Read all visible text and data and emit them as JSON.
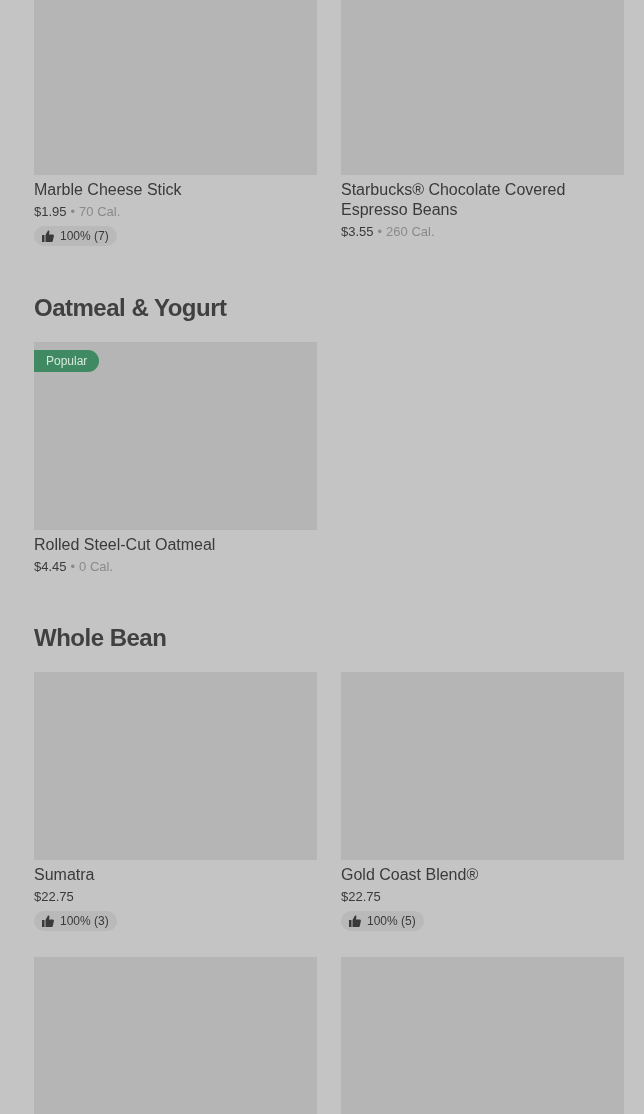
{
  "sections": [
    {
      "items": [
        {
          "kind": "product",
          "name": "Marble Cheese Stick",
          "price": "$1.95",
          "separator": "•",
          "calories": "70 Cal.",
          "rating": "100% (7)"
        },
        {
          "kind": "product",
          "name": "Starbucks® Chocolate Covered Espresso Beans",
          "price": "$3.55",
          "separator": "•",
          "calories": "260 Cal."
        }
      ]
    },
    {
      "title": "Oatmeal & Yogurt",
      "items": [
        {
          "kind": "product",
          "badge": "Popular",
          "name": "Rolled Steel-Cut Oatmeal",
          "price": "$4.45",
          "separator": "•",
          "calories": "0 Cal."
        }
      ]
    },
    {
      "title": "Whole Bean",
      "items": [
        {
          "kind": "product",
          "name": "Sumatra",
          "price": "$22.75",
          "rating": "100% (3)"
        },
        {
          "kind": "product",
          "name": "Gold Coast Blend®",
          "price": "$22.75",
          "rating": "100% (5)"
        },
        {
          "kind": "image-only"
        },
        {
          "kind": "image-only"
        }
      ]
    }
  ]
}
